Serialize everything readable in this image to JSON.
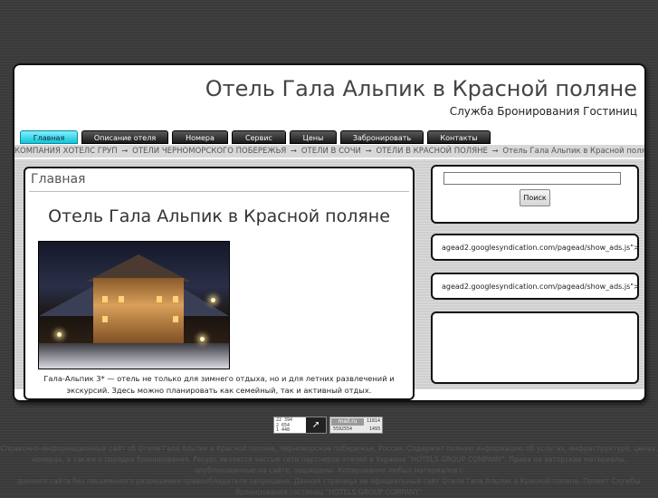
{
  "header": {
    "title": "Отель Гала Альпик в Красной поляне",
    "subtitle": "Служба Бронирования Гостиниц"
  },
  "nav": {
    "items": [
      {
        "label": "Главная",
        "active": true
      },
      {
        "label": "Описание отеля"
      },
      {
        "label": "Номера"
      },
      {
        "label": "Сервис"
      },
      {
        "label": "Цены"
      },
      {
        "label": "Забронировать"
      },
      {
        "label": "Контакты"
      }
    ]
  },
  "breadcrumb": {
    "items": [
      "КОМПАНИЯ ХОТЕЛС ГРУП",
      "ОТЕЛИ ЧЕРНОМОРСКОГО ПОБЕРЕЖЬЯ",
      "ОТЕЛИ В СОЧИ",
      "ОТЕЛИ В КРАСНОЙ ПОЛЯНЕ"
    ],
    "separator": "➞",
    "current": "Отель Гала Альпик в Красной поляне"
  },
  "main": {
    "heading": "Главная",
    "hotel_title": "Отель Гала Альпик в Красной поляне",
    "caption_line1": "Гала-Альпик 3* — отель не только для зимнего отдыха, но и для летних развлечений и",
    "caption_line2": "экскурсий.  Здесь можно планировать как семейный, так и активный отдых."
  },
  "sidebar": {
    "search_value": "",
    "search_button": "Поиск",
    "ad1": "agead2.googlesyndication.com/pagead/show_ads.js\">",
    "ad2": "agead2.googlesyndication.com/pagead/show_ads.js\">"
  },
  "counters": {
    "c1_line1": "22 394",
    "c1_line2": "2 654",
    "c1_line3": "1 448",
    "c2_logo": "mail.ru",
    "c2_total": "5592554",
    "c2_top": "11814",
    "c2_bottom": "1493"
  },
  "footer": {
    "line1": "Справочно-информационный сайт об Отеле Гала Альпик в Красной поляне, Черноморское побережье, Россия. Содержит полную информацию об услугах, инфраструктуре, ценах,",
    "line2": "номерах, а также о порядке бронирования. Ресурс является частью сети партнеров отелей в Украине \"HOTELS GROUP COMPANY\". Права на авторские материалы, опубликованные на сайте, защищены. Копирование любых материалов с",
    "line3": "данного сайта без письменного разрешения правообладателя запрещено. Данная страница не официальный сайт Отеля Гала Альпик в Красной поляне. Проект Службы",
    "line4": "бронирования гостиниц \"HOTELS GROUP COMPANY\""
  }
}
